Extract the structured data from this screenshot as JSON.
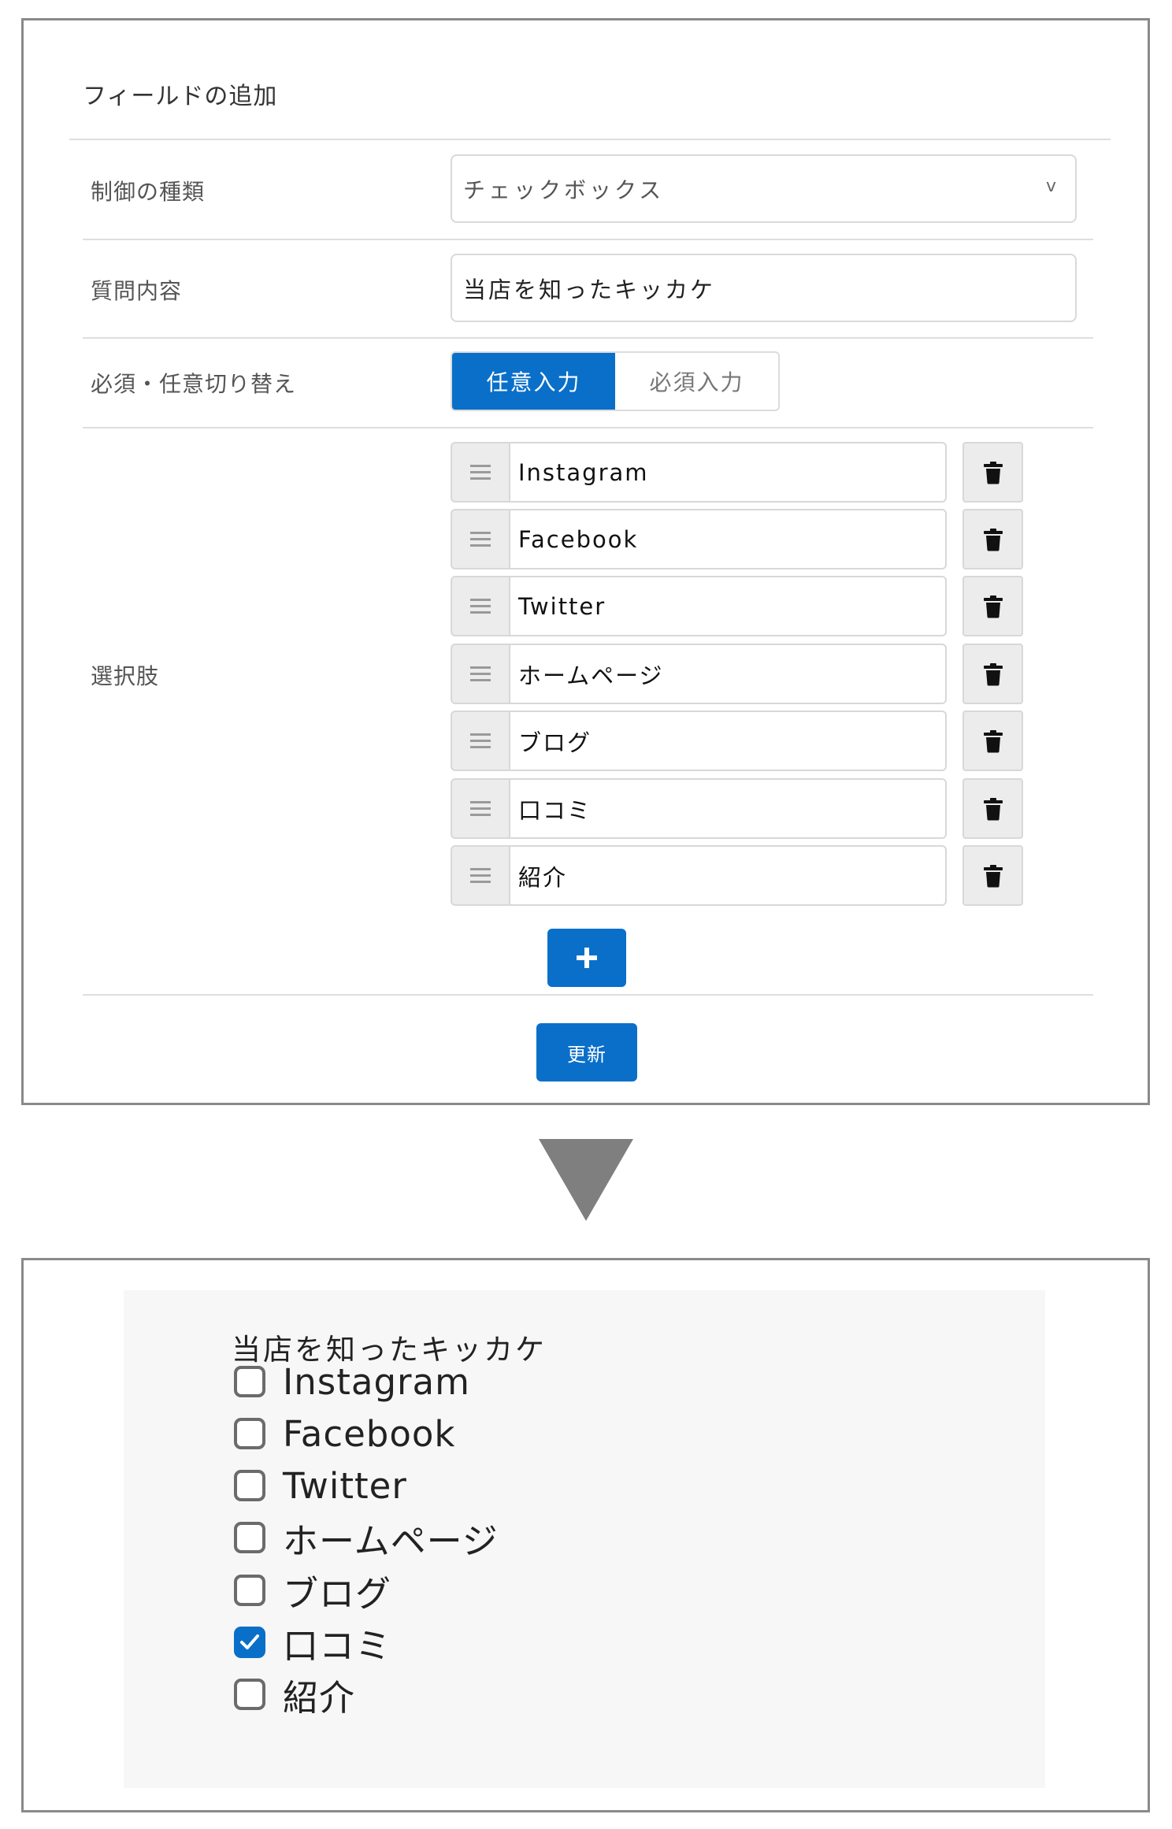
{
  "editor": {
    "title": "フィールドの追加",
    "control_type": {
      "label": "制御の種類",
      "value": "チェックボックス",
      "chevron": "v"
    },
    "question": {
      "label": "質問内容",
      "value": "当店を知ったキッカケ"
    },
    "required": {
      "label": "必須・任意切り替え",
      "options": [
        "任意入力",
        "必須入力"
      ],
      "selected": "任意入力"
    },
    "choices": {
      "label": "選択肢",
      "items": [
        "Instagram",
        "Facebook",
        "Twitter",
        "ホームページ",
        "ブログ",
        "口コミ",
        "紹介"
      ]
    },
    "add_button_icon": "plus-icon",
    "update_label": "更新"
  },
  "colors": {
    "accent": "#0a6fc9",
    "arrow": "#7f7f7f",
    "preview_bg": "#f7f7f7"
  },
  "preview": {
    "title": "当店を知ったキッカケ",
    "options": [
      {
        "label": "Instagram",
        "checked": false
      },
      {
        "label": "Facebook",
        "checked": false
      },
      {
        "label": "Twitter",
        "checked": false
      },
      {
        "label": "ホームページ",
        "checked": false
      },
      {
        "label": "ブログ",
        "checked": false
      },
      {
        "label": "口コミ",
        "checked": true
      },
      {
        "label": "紹介",
        "checked": false
      }
    ]
  }
}
